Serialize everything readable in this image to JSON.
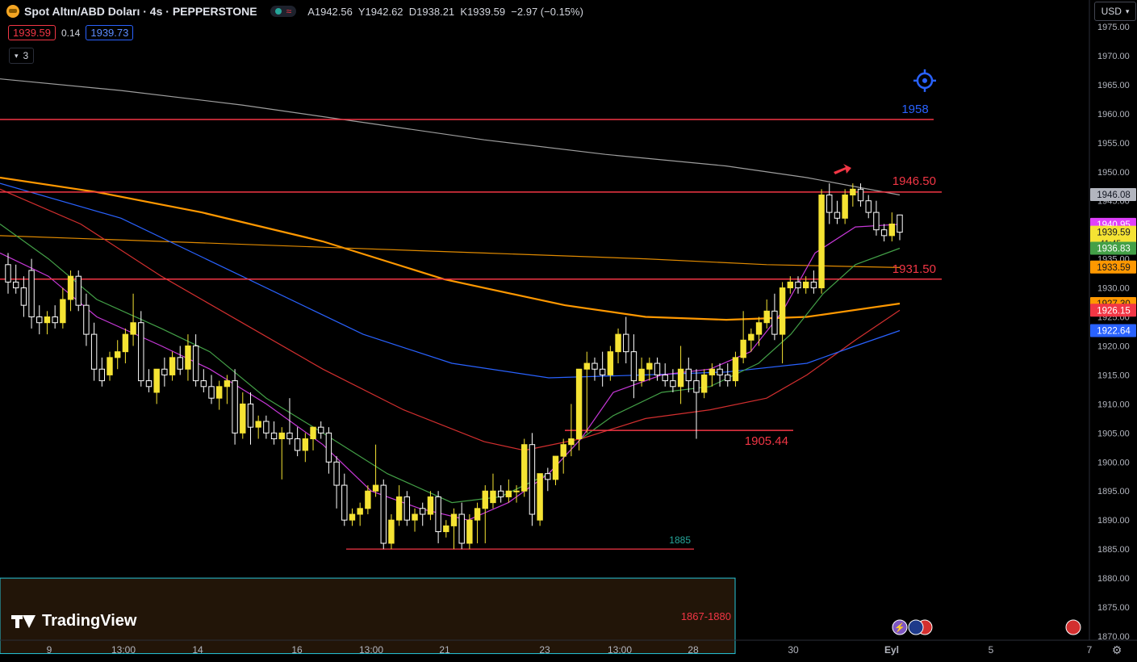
{
  "header": {
    "title": "Spot Altın/ABD Doları · 4s · PEPPERSTONE",
    "open_label": "A",
    "open": "1942.56",
    "high_label": "Y",
    "high": "1942.62",
    "low_label": "D",
    "low": "1938.21",
    "close_label": "K",
    "close": "1939.59",
    "change": "−2.97 (−0.15%)"
  },
  "quote": {
    "sell": "1939.59",
    "spread": "0.14",
    "buy": "1939.73"
  },
  "indicator_toggle": {
    "label": "3"
  },
  "currency": {
    "label": "USD"
  },
  "branding": {
    "label": "TradingView"
  },
  "icons": {
    "alert": "alert-target-icon",
    "settings": "gear-icon",
    "lightning": "lightning-icon",
    "flag": "us-flag-icon"
  },
  "colors": {
    "up": "#f5e333",
    "down": "#ffffff",
    "level": "#f23645",
    "ema_fast": "#c738d8",
    "ema_mid": "#43a047",
    "ema_red": "#d32f2f",
    "ema_blue": "#2962ff",
    "ema_orange": "#ff9800",
    "ema_gray": "#9e9e9e"
  },
  "chart_data": {
    "type": "candlestick",
    "symbol": "Spot Altın/ABD Doları",
    "timeframe": "4s",
    "ylim": [
      1870,
      1975
    ],
    "y_ticks": [
      "1975.00",
      "1970.00",
      "1965.00",
      "1960.00",
      "1955.00",
      "1950.00",
      "1945.00",
      "1940.00",
      "1935.00",
      "1930.00",
      "1925.00",
      "1920.00",
      "1915.00",
      "1910.00",
      "1905.00",
      "1900.00",
      "1895.00",
      "1890.00",
      "1885.00",
      "1880.00",
      "1875.00",
      "1870.00"
    ],
    "x_ticks": [
      "9",
      "13:00",
      "14",
      "16",
      "13:00",
      "21",
      "23",
      "13:00",
      "28",
      "30",
      "Eyl",
      "5",
      "7"
    ],
    "levels": [
      {
        "label": "1958",
        "value": 1959.0,
        "color": "#2962ff"
      },
      {
        "label": "1946.50",
        "value": 1946.5,
        "color": "#f23645"
      },
      {
        "label": "1931.50",
        "value": 1931.5,
        "color": "#f23645"
      },
      {
        "label": "1905.44",
        "value": 1905.44,
        "color": "#f23645"
      },
      {
        "label": "1885",
        "value": 1885.0,
        "color": "#26a69a"
      }
    ],
    "zone": {
      "label": "1867-1880",
      "low": 1867,
      "high": 1880
    },
    "price_tags": [
      {
        "label": "1946.08",
        "value": 1946.08,
        "bg": "#b2b5be",
        "fg": "#131722"
      },
      {
        "label": "1940.95",
        "value": 1940.95,
        "bg": "#e040fb",
        "fg": "#ffffff"
      },
      {
        "label": "1939.59",
        "value": 1939.59,
        "bg": "#f5e333",
        "fg": "#131722",
        "countdown": "41:45"
      },
      {
        "label": "1936.83",
        "value": 1936.83,
        "bg": "#43a047",
        "fg": "#ffffff"
      },
      {
        "label": "1933.59",
        "value": 1933.59,
        "bg": "#ff9800",
        "fg": "#131722"
      },
      {
        "label": "1927.30",
        "value": 1927.3,
        "bg": "#ff9800",
        "fg": "#131722"
      },
      {
        "label": "1926.15",
        "value": 1926.15,
        "bg": "#f23645",
        "fg": "#ffffff"
      },
      {
        "label": "1922.64",
        "value": 1922.64,
        "bg": "#2962ff",
        "fg": "#ffffff"
      }
    ],
    "candles": [
      [
        1934,
        1936,
        1929,
        1931
      ],
      [
        1931,
        1934,
        1929,
        1930
      ],
      [
        1930,
        1932,
        1925,
        1927
      ],
      [
        1933,
        1935,
        1923,
        1925
      ],
      [
        1925,
        1927,
        1922,
        1924
      ],
      [
        1924,
        1926,
        1922,
        1925
      ],
      [
        1925,
        1927,
        1923,
        1924
      ],
      [
        1924,
        1930,
        1923,
        1928
      ],
      [
        1928,
        1933,
        1926,
        1932
      ],
      [
        1932,
        1933,
        1926,
        1927
      ],
      [
        1927,
        1929,
        1920,
        1922
      ],
      [
        1922,
        1924,
        1914,
        1916
      ],
      [
        1916,
        1918,
        1913,
        1914
      ],
      [
        1915,
        1919,
        1914,
        1918
      ],
      [
        1918,
        1921,
        1916,
        1919
      ],
      [
        1919,
        1923,
        1917,
        1922
      ],
      [
        1922,
        1929,
        1920,
        1924
      ],
      [
        1924,
        1926,
        1913,
        1914
      ],
      [
        1914,
        1916,
        1912,
        1913
      ],
      [
        1912,
        1916,
        1910,
        1916
      ],
      [
        1916,
        1918,
        1913,
        1915
      ],
      [
        1915,
        1919,
        1914,
        1918
      ],
      [
        1918,
        1920,
        1915,
        1916
      ],
      [
        1916,
        1922,
        1914,
        1920
      ],
      [
        1920,
        1922,
        1913,
        1914
      ],
      [
        1914,
        1916,
        1912,
        1913
      ],
      [
        1913,
        1915,
        1910,
        1911
      ],
      [
        1911,
        1914,
        1909,
        1913
      ],
      [
        1913,
        1915,
        1910,
        1914
      ],
      [
        1914,
        1916,
        1903,
        1905
      ],
      [
        1905,
        1912,
        1904,
        1910
      ],
      [
        1910,
        1912,
        1903,
        1906
      ],
      [
        1906,
        1908,
        1904,
        1907
      ],
      [
        1907,
        1908,
        1904,
        1905
      ],
      [
        1905,
        1907,
        1903,
        1904
      ],
      [
        1904,
        1906,
        1897,
        1905
      ],
      [
        1905,
        1911,
        1903,
        1904
      ],
      [
        1904,
        1906,
        1901,
        1902
      ],
      [
        1902,
        1905,
        1900,
        1904
      ],
      [
        1904,
        1906,
        1902,
        1906
      ],
      [
        1906,
        1907,
        1904,
        1905
      ],
      [
        1905,
        1906,
        1898,
        1900
      ],
      [
        1900,
        1901,
        1892,
        1896
      ],
      [
        1896,
        1898,
        1889,
        1890
      ],
      [
        1890,
        1892,
        1889,
        1891
      ],
      [
        1891,
        1893,
        1889,
        1892
      ],
      [
        1892,
        1896,
        1891,
        1895
      ],
      [
        1895,
        1903,
        1894,
        1896
      ],
      [
        1896,
        1897,
        1885,
        1886
      ],
      [
        1886,
        1891,
        1885,
        1890
      ],
      [
        1890,
        1896,
        1889,
        1894
      ],
      [
        1894,
        1895,
        1889,
        1890
      ],
      [
        1890,
        1892,
        1888,
        1891
      ],
      [
        1892,
        1893,
        1889,
        1891
      ],
      [
        1891,
        1895,
        1890,
        1894
      ],
      [
        1894,
        1895,
        1886,
        1888
      ],
      [
        1888,
        1890,
        1887,
        1889
      ],
      [
        1889,
        1892,
        1885,
        1891
      ],
      [
        1891,
        1893,
        1885,
        1886
      ],
      [
        1886,
        1891,
        1885,
        1890
      ],
      [
        1890,
        1893,
        1886,
        1892
      ],
      [
        1892,
        1896,
        1886,
        1895
      ],
      [
        1893,
        1898,
        1892,
        1895
      ],
      [
        1895,
        1896,
        1893,
        1894
      ],
      [
        1894,
        1897,
        1893,
        1895
      ],
      [
        1895,
        1896,
        1893,
        1895
      ],
      [
        1895,
        1904,
        1894,
        1903
      ],
      [
        1903,
        1905,
        1889,
        1891
      ],
      [
        1890,
        1895,
        1889,
        1898
      ],
      [
        1898,
        1899,
        1895,
        1897
      ],
      [
        1897,
        1901,
        1896,
        1901
      ],
      [
        1901,
        1904,
        1898,
        1903
      ],
      [
        1903,
        1910,
        1901,
        1904
      ],
      [
        1904,
        1906,
        1902,
        1916
      ],
      [
        1916,
        1919,
        1905,
        1917
      ],
      [
        1917,
        1918,
        1914,
        1916
      ],
      [
        1916,
        1919,
        1913,
        1915
      ],
      [
        1915,
        1920,
        1914,
        1919
      ],
      [
        1919,
        1923,
        1917,
        1922
      ],
      [
        1922,
        1925,
        1917,
        1919
      ],
      [
        1919,
        1922,
        1911,
        1914
      ],
      [
        1914,
        1918,
        1913,
        1916
      ],
      [
        1916,
        1918,
        1914,
        1917
      ],
      [
        1917,
        1918,
        1914,
        1915
      ],
      [
        1915,
        1917,
        1913,
        1914
      ],
      [
        1914,
        1916,
        1912,
        1913
      ],
      [
        1913,
        1920,
        1910,
        1916
      ],
      [
        1916,
        1918,
        1912,
        1914
      ],
      [
        1914,
        1916,
        1904,
        1912
      ],
      [
        1912,
        1916,
        1911,
        1915
      ],
      [
        1915,
        1917,
        1913,
        1916
      ],
      [
        1916,
        1917,
        1913,
        1915
      ],
      [
        1915,
        1917,
        1913,
        1914
      ],
      [
        1914,
        1919,
        1913,
        1918
      ],
      [
        1918,
        1926,
        1917,
        1921
      ],
      [
        1921,
        1923,
        1919,
        1922
      ],
      [
        1922,
        1925,
        1920,
        1924
      ],
      [
        1924,
        1928,
        1923,
        1926
      ],
      [
        1926,
        1929,
        1921,
        1922
      ],
      [
        1922,
        1931,
        1917,
        1930
      ],
      [
        1930,
        1932,
        1929,
        1931
      ],
      [
        1931,
        1932,
        1929,
        1930
      ],
      [
        1930,
        1932,
        1929,
        1931
      ],
      [
        1931,
        1933,
        1929,
        1930
      ],
      [
        1930,
        1947,
        1929,
        1946
      ],
      [
        1946,
        1948,
        1941,
        1943
      ],
      [
        1943,
        1945,
        1941,
        1942
      ],
      [
        1942,
        1947,
        1941,
        1946
      ],
      [
        1946,
        1948,
        1944,
        1947
      ],
      [
        1947,
        1948,
        1944,
        1945
      ],
      [
        1945,
        1946,
        1942,
        1943
      ],
      [
        1943,
        1945,
        1939,
        1940
      ],
      [
        1940,
        1941,
        1938,
        1939
      ],
      [
        1939,
        1943,
        1938,
        1941
      ],
      [
        1942.56,
        1942.62,
        1938.21,
        1939.59
      ]
    ]
  }
}
